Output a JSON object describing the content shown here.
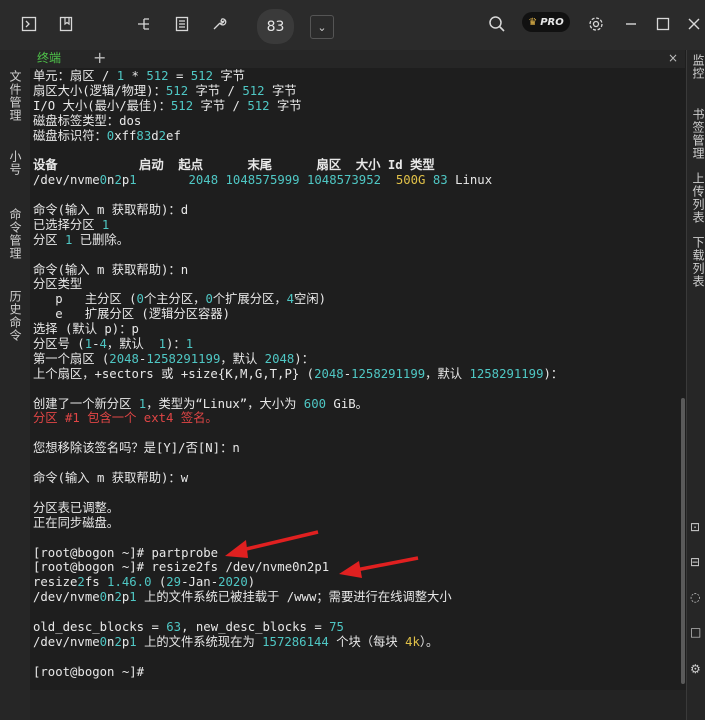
{
  "toolbar": {
    "tab_label": "83",
    "pro_label": "PRO",
    "icons": [
      "terminal-icon",
      "bookmark-icon",
      "tree-icon",
      "document-icon",
      "wrench-icon",
      "search-icon",
      "settings-icon",
      "minimize-icon",
      "maximize-icon",
      "close-icon"
    ]
  },
  "left_panel": {
    "items": [
      "文件管理",
      "小号",
      "命令管理",
      "历史命令"
    ]
  },
  "right_panel": {
    "items": [
      "监控",
      "书签管理",
      "上传列表",
      "下载列表"
    ]
  },
  "tabs": {
    "active_label": "终端",
    "add_label": "+",
    "close_label": "×"
  },
  "terminal": {
    "lines": [
      "单元：扇区 / 1 * 512 = 512 字节",
      "扇区大小(逻辑/物理)：512 字节 / 512 字节",
      "I/O 大小(最小/最佳)：512 字节 / 512 字节",
      "磁盘标签类型：dos",
      "磁盘标识符：0xff83d2ef",
      "",
      "设备           启动  起点      末尾      扇区  大小 Id 类型",
      "/dev/nvme0n2p1       2048 1048575999 1048573952  500G 83 Linux",
      "",
      "命令(输入 m 获取帮助)：d",
      "已选择分区 1",
      "分区 1 已删除。",
      "",
      "命令(输入 m 获取帮助)：n",
      "分区类型",
      "   p   主分区 (0个主分区，0个扩展分区，4空闲)",
      "   e   扩展分区 (逻辑分区容器)",
      "选择 (默认 p)：p",
      "分区号 (1-4，默认  1)：1",
      "第一个扇区 (2048-1258291199，默认 2048)：",
      "上个扇区，+sectors 或 +size{K,M,G,T,P} (2048-1258291199，默认 1258291199)：",
      "",
      "创建了一个新分区 1，类型为“Linux”，大小为 600 GiB。",
      "分区 #1 包含一个 ext4 签名。",
      "",
      "您想移除该签名吗？是[Y]/否[N]：n",
      "",
      "命令(输入 m 获取帮助)：w",
      "",
      "分区表已调整。",
      "正在同步磁盘。",
      "",
      "[root@bogon ~]# partprobe",
      "[root@bogon ~]# resize2fs /dev/nvme0n2p1",
      "resize2fs 1.46.0 (29-Jan-2020)",
      "/dev/nvme0n2p1 上的文件系统已被挂载于 /www；需要进行在线调整大小",
      "",
      "old_desc_blocks = 63, new_desc_blocks = 75",
      "/dev/nvme0n2p1 上的文件系统现在为 157286144 个块（每块 4k）。",
      "",
      "[root@bogon ~]#"
    ]
  },
  "colors": {
    "terminal_bg": "#1e1e1e",
    "text": "#e8e8e8",
    "number": "#4fc7c4",
    "size_highlight": "#e0c048",
    "warning": "#e04545",
    "accent_tab": "#4fc44a",
    "annotation_arrow": "#e02020"
  }
}
